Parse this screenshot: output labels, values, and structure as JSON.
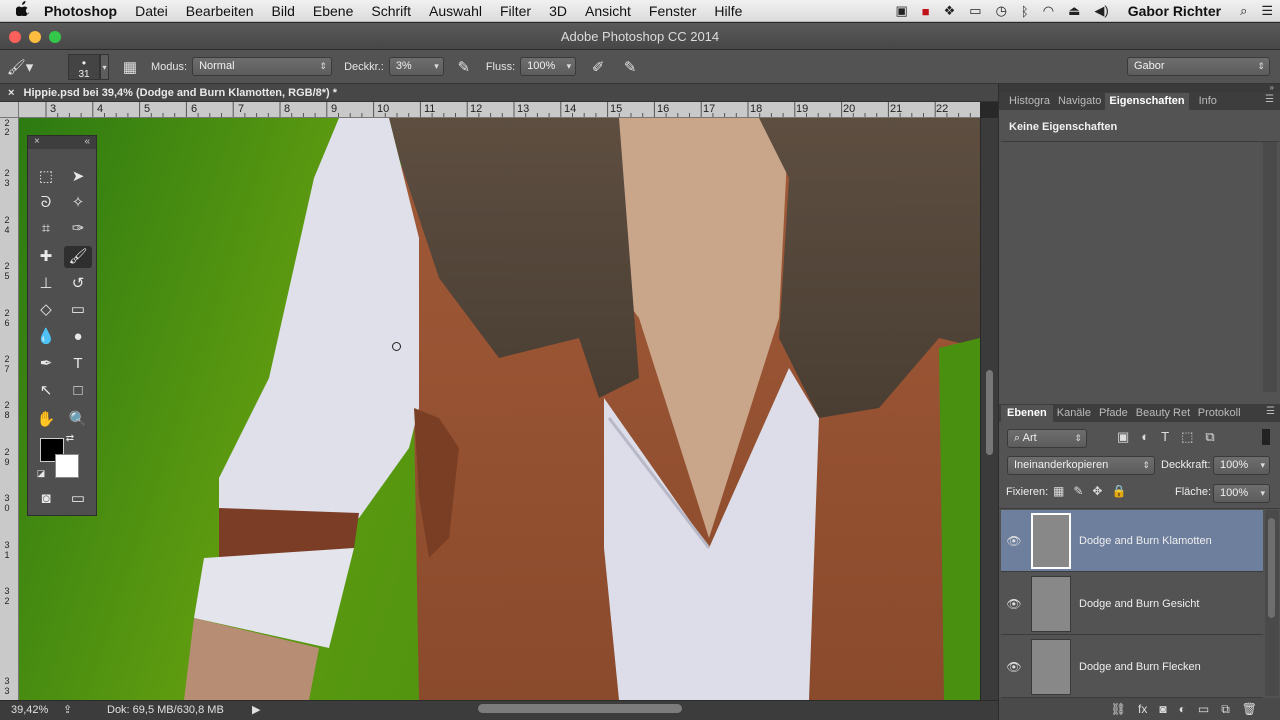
{
  "menubar": {
    "apple": "",
    "items": [
      "Photoshop",
      "Datei",
      "Bearbeiten",
      "Bild",
      "Ebene",
      "Schrift",
      "Auswahl",
      "Filter",
      "3D",
      "Ansicht",
      "Fenster",
      "Hilfe"
    ],
    "user": "Gabor Richter"
  },
  "window": {
    "title": "Adobe Photoshop CC 2014"
  },
  "options": {
    "brush_size": "31",
    "mode_label": "Modus:",
    "mode_value": "Normal",
    "opacity_label": "Deckkr.:",
    "opacity_value": "3%",
    "flow_label": "Fluss:",
    "flow_value": "100%",
    "workspace": "Gabor"
  },
  "document": {
    "tab_title": "Hippie.psd bei 39,4% (Dodge and Burn Klamotten, RGB/8*) *",
    "close": "×"
  },
  "rulers": {
    "h": [
      "3",
      "4",
      "5",
      "6",
      "7",
      "8",
      "9",
      "10",
      "11",
      "12",
      "13",
      "14",
      "15",
      "16",
      "17",
      "18",
      "19",
      "20",
      "21",
      "22"
    ],
    "v": [
      "2",
      "2",
      "2 3",
      "2 4",
      "2 5",
      "2 6",
      "2 7",
      "2 8",
      "2 9",
      "3 0",
      "3 1",
      "3 2",
      "3 3"
    ]
  },
  "status": {
    "zoom": "39,42%",
    "doc": "Dok: 69,5 MB/630,8 MB"
  },
  "properties_panel": {
    "tabs": [
      "Histogra",
      "Navigato",
      "Eigenschaften",
      "Info"
    ],
    "active_tab": "Eigenschaften",
    "content": "Keine Eigenschaften"
  },
  "layers_panel": {
    "tabs": [
      "Ebenen",
      "Kanäle",
      "Pfade",
      "Beauty Ret",
      "Protokoll"
    ],
    "filter": "Art",
    "blend_mode": "Ineinanderkopieren",
    "opacity_label": "Deckkraft:",
    "opacity_value": "100%",
    "lock_label": "Fixieren:",
    "fill_label": "Fläche:",
    "fill_value": "100%",
    "layers": [
      {
        "name": "Dodge and Burn Klamotten",
        "selected": true
      },
      {
        "name": "Dodge and Burn Gesicht",
        "selected": false
      },
      {
        "name": "Dodge and Burn Flecken",
        "selected": false
      }
    ]
  },
  "colors": {
    "foreground": "#000000",
    "background": "#ffffff",
    "selection": "#6d7f9d"
  }
}
